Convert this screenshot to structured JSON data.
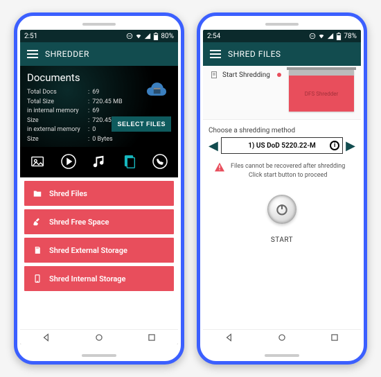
{
  "phone1": {
    "status": {
      "time": "2:51",
      "battery_pct": "80%"
    },
    "appbar": {
      "title": "SHREDDER"
    },
    "documents": {
      "title": "Documents",
      "stats": [
        {
          "label": "Total Docs",
          "value": "69"
        },
        {
          "label": "Total Size",
          "value": "720.45 MB"
        },
        {
          "label": "in internal memory",
          "value": "69"
        },
        {
          "label": "Size",
          "value": "720.45 MB"
        },
        {
          "label": "in external memory",
          "value": "0"
        },
        {
          "label": "Size",
          "value": "0 Bytes"
        }
      ],
      "select_label": "SELECT FILES"
    },
    "types": [
      {
        "name": "photos-icon"
      },
      {
        "name": "video-icon"
      },
      {
        "name": "music-icon"
      },
      {
        "name": "documents-icon"
      },
      {
        "name": "whatsapp-icon"
      }
    ],
    "actions": [
      {
        "name": "folder-icon",
        "label": "Shred Files"
      },
      {
        "name": "broom-icon",
        "label": "Shred Free Space"
      },
      {
        "name": "sdcard-icon",
        "label": "Shred External Storage"
      },
      {
        "name": "phone-icon",
        "label": "Shred Internal Storage"
      }
    ]
  },
  "phone2": {
    "status": {
      "time": "2:54",
      "battery_pct": "78%"
    },
    "appbar": {
      "title": "SHRED FILES"
    },
    "start_shred_label": "Start Shredding",
    "shredder_badge": "DFS Shredder",
    "method": {
      "caption": "Choose a shredding method",
      "selected": "1) US DoD 5220.22-M"
    },
    "warning": {
      "line1": "Files cannot be recovered after shredding",
      "line2": "Click start button to proceed"
    },
    "start_label": "START"
  }
}
